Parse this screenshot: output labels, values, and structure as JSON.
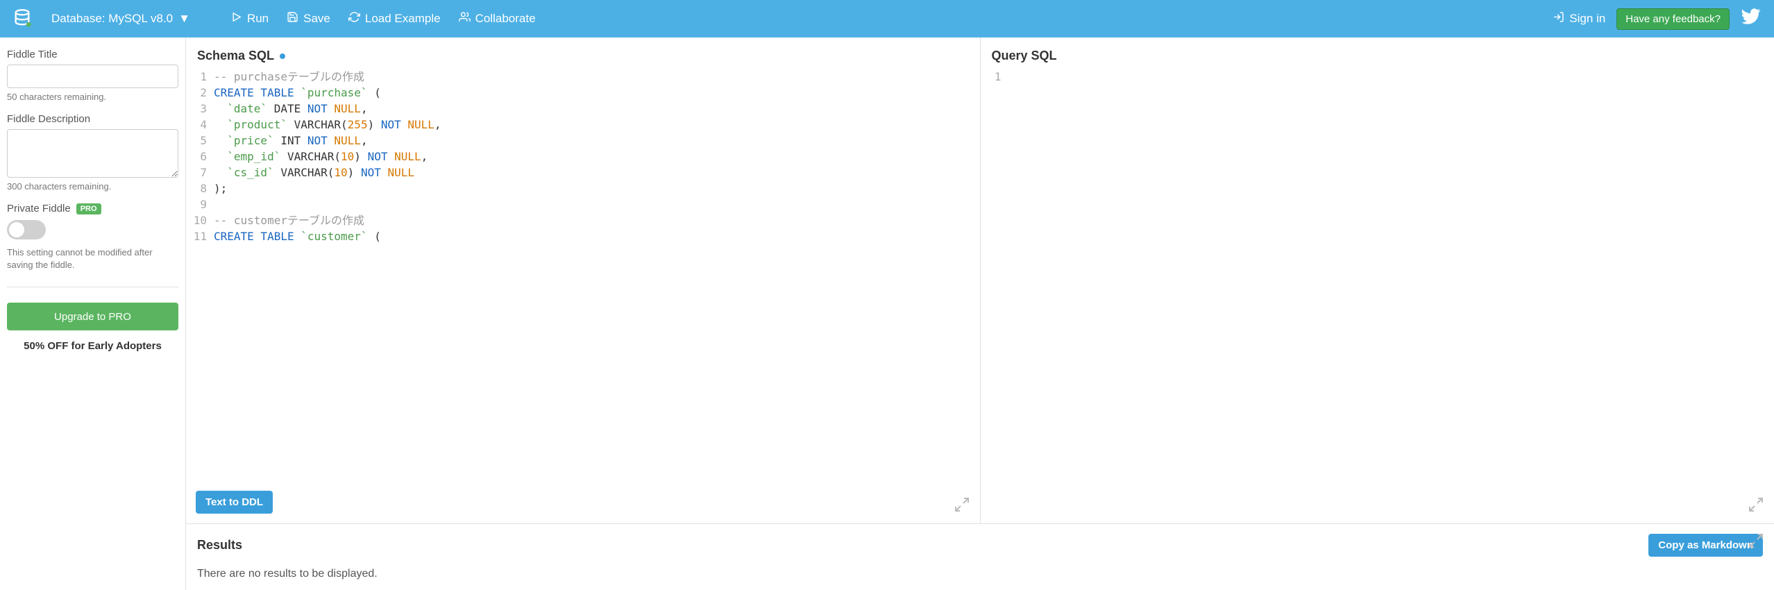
{
  "header": {
    "db_label": "Database: MySQL v8.0",
    "run": "Run",
    "save": "Save",
    "load_example": "Load Example",
    "collaborate": "Collaborate",
    "sign_in": "Sign in",
    "feedback": "Have any feedback?"
  },
  "sidebar": {
    "title_label": "Fiddle Title",
    "title_value": "",
    "title_remaining": "50 characters remaining.",
    "desc_label": "Fiddle Description",
    "desc_value": "",
    "desc_remaining": "300 characters remaining.",
    "private_label": "Private Fiddle",
    "pro_badge": "PRO",
    "private_note": "This setting cannot be modified after saving the fiddle.",
    "upgrade": "Upgrade to PRO",
    "promo": "50% OFF for Early Adopters"
  },
  "panes": {
    "schema_title": "Schema SQL",
    "query_title": "Query SQL",
    "text_to_ddl": "Text to DDL"
  },
  "schema_lines": [
    [
      {
        "t": "-- purchaseテーブルの作成",
        "c": "c-cmt"
      }
    ],
    [
      {
        "t": "CREATE TABLE",
        "c": "c-kw"
      },
      {
        "t": " "
      },
      {
        "t": "`purchase`",
        "c": "c-id"
      },
      {
        "t": " ("
      }
    ],
    [
      {
        "t": "  "
      },
      {
        "t": "`date`",
        "c": "c-id"
      },
      {
        "t": " DATE "
      },
      {
        "t": "NOT",
        "c": "c-kw"
      },
      {
        "t": " "
      },
      {
        "t": "NULL",
        "c": "c-null"
      },
      {
        "t": ","
      }
    ],
    [
      {
        "t": "  "
      },
      {
        "t": "`product`",
        "c": "c-id"
      },
      {
        "t": " VARCHAR("
      },
      {
        "t": "255",
        "c": "c-num"
      },
      {
        "t": ") "
      },
      {
        "t": "NOT",
        "c": "c-kw"
      },
      {
        "t": " "
      },
      {
        "t": "NULL",
        "c": "c-null"
      },
      {
        "t": ","
      }
    ],
    [
      {
        "t": "  "
      },
      {
        "t": "`price`",
        "c": "c-id"
      },
      {
        "t": " INT "
      },
      {
        "t": "NOT",
        "c": "c-kw"
      },
      {
        "t": " "
      },
      {
        "t": "NULL",
        "c": "c-null"
      },
      {
        "t": ","
      }
    ],
    [
      {
        "t": "  "
      },
      {
        "t": "`emp_id`",
        "c": "c-id"
      },
      {
        "t": " VARCHAR("
      },
      {
        "t": "10",
        "c": "c-num"
      },
      {
        "t": ") "
      },
      {
        "t": "NOT",
        "c": "c-kw"
      },
      {
        "t": " "
      },
      {
        "t": "NULL",
        "c": "c-null"
      },
      {
        "t": ","
      }
    ],
    [
      {
        "t": "  "
      },
      {
        "t": "`cs_id`",
        "c": "c-id"
      },
      {
        "t": " VARCHAR("
      },
      {
        "t": "10",
        "c": "c-num"
      },
      {
        "t": ") "
      },
      {
        "t": "NOT",
        "c": "c-kw"
      },
      {
        "t": " "
      },
      {
        "t": "NULL",
        "c": "c-null"
      }
    ],
    [
      {
        "t": ");"
      }
    ],
    [
      {
        "t": ""
      }
    ],
    [
      {
        "t": "-- customerテーブルの作成",
        "c": "c-cmt"
      }
    ],
    [
      {
        "t": "CREATE TABLE",
        "c": "c-kw"
      },
      {
        "t": " "
      },
      {
        "t": "`customer`",
        "c": "c-id"
      },
      {
        "t": " ("
      }
    ]
  ],
  "query_lines": [
    [
      {
        "t": ""
      }
    ]
  ],
  "results": {
    "title": "Results",
    "copy_md": "Copy as Markdown",
    "empty": "There are no results to be displayed."
  }
}
